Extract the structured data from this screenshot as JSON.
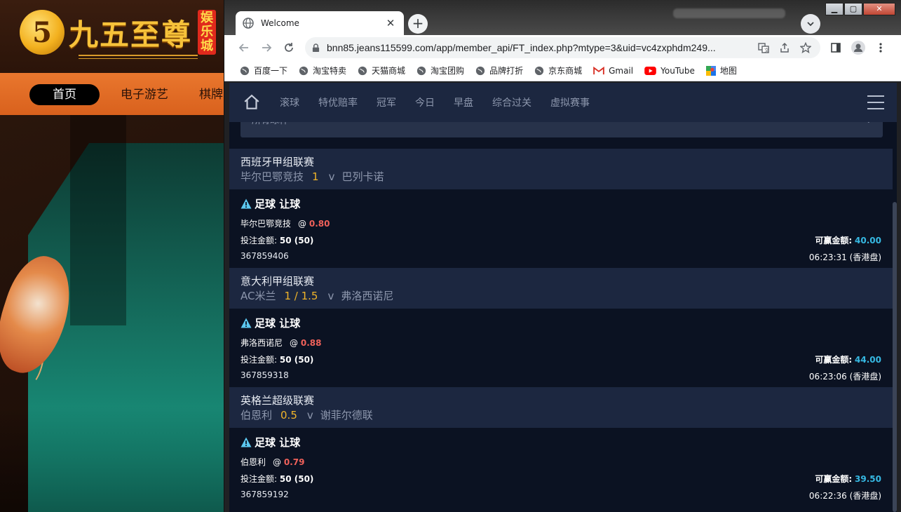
{
  "background_site": {
    "logo_text": "九五至尊",
    "logo_badge": "娱乐城",
    "nav": [
      "首页",
      "电子游艺",
      "棋牌"
    ]
  },
  "browser": {
    "tab_title": "Welcome",
    "url": "bnn85.jeans115599.com/app/member_api/FT_index.php?mtype=3&uid=vc4zxphdm249...",
    "bookmarks": [
      {
        "label": "百度一下",
        "icon": "globe-icon"
      },
      {
        "label": "淘宝特卖",
        "icon": "globe-icon"
      },
      {
        "label": "天猫商城",
        "icon": "globe-icon"
      },
      {
        "label": "淘宝团购",
        "icon": "globe-icon"
      },
      {
        "label": "品牌打折",
        "icon": "globe-icon"
      },
      {
        "label": "京东商城",
        "icon": "globe-icon"
      },
      {
        "label": "Gmail",
        "icon": "gmail-icon"
      },
      {
        "label": "YouTube",
        "icon": "youtube-icon"
      },
      {
        "label": "地图",
        "icon": "maps-icon"
      }
    ]
  },
  "app": {
    "nav_items": [
      "滚球",
      "特优赔率",
      "冠军",
      "今日",
      "早盘",
      "综合过关",
      "虚拟赛事"
    ],
    "filter_label": "所有球种",
    "bets": [
      {
        "league": "西班牙甲组联赛",
        "home": "毕尔巴鄂竞技",
        "handicap": "1",
        "vs": "v",
        "away": "巴列卡诺",
        "bet_type": "足球 让球",
        "pick": "毕尔巴鄂竞技",
        "at": "@",
        "odds": "0.80",
        "stake_label": "投注金额:",
        "stake": "50 (50)",
        "win_label": "可赢金额:",
        "win": "40.00",
        "ticket": "367859406",
        "time": "06:23:31 (香港盘)"
      },
      {
        "league": "意大利甲组联赛",
        "home": "AC米兰",
        "handicap": "1 / 1.5",
        "vs": "v",
        "away": "弗洛西诺尼",
        "bet_type": "足球 让球",
        "pick": "弗洛西诺尼",
        "at": "@",
        "odds": "0.88",
        "stake_label": "投注金额:",
        "stake": "50 (50)",
        "win_label": "可赢金额:",
        "win": "44.00",
        "ticket": "367859318",
        "time": "06:23:06 (香港盘)"
      },
      {
        "league": "英格兰超级联赛",
        "home": "伯恩利",
        "handicap": "0.5",
        "vs": "v",
        "away": "谢菲尔德联",
        "bet_type": "足球 让球",
        "pick": "伯恩利",
        "at": "@",
        "odds": "0.79",
        "stake_label": "投注金额:",
        "stake": "50 (50)",
        "win_label": "可赢金额:",
        "win": "39.50",
        "ticket": "367859192",
        "time": "06:22:36 (香港盘)"
      }
    ]
  },
  "colors": {
    "accent_odds": "#f0615a",
    "accent_win": "#36b9e3",
    "handicap": "#f0b429",
    "nav_bg": "#1c2740",
    "page_bg": "#0b1222"
  }
}
